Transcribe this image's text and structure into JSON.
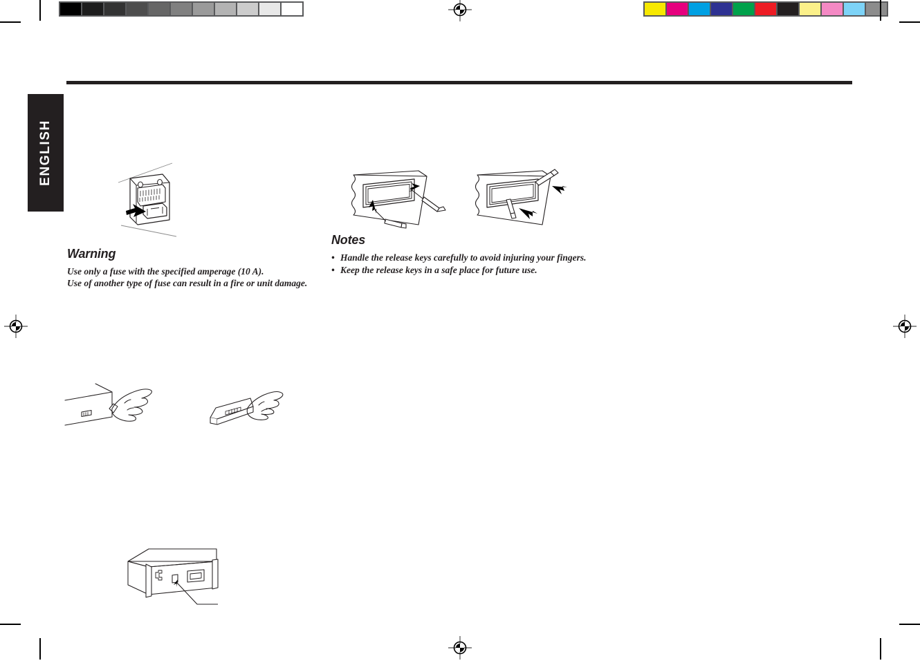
{
  "page": {
    "background_color": "#ffffff",
    "ink_color": "#231f20",
    "language_tab": {
      "label": "ENGLISH",
      "background_color": "#231f20",
      "text_color": "#ffffff"
    },
    "header_rule": {
      "color": "#231f20"
    }
  },
  "calibration": {
    "grayscale_strip": {
      "name": "grayscale-step-wedge",
      "frame_color": "#58595b",
      "patches": [
        {
          "label": "100%",
          "color": "#000000"
        },
        {
          "label": "90%",
          "color": "#1d1d1d"
        },
        {
          "label": "80%",
          "color": "#333333"
        },
        {
          "label": "70%",
          "color": "#4d4d4d"
        },
        {
          "label": "60%",
          "color": "#666666"
        },
        {
          "label": "50%",
          "color": "#808080"
        },
        {
          "label": "40%",
          "color": "#9a9a9a"
        },
        {
          "label": "30%",
          "color": "#b3b3b3"
        },
        {
          "label": "20%",
          "color": "#cccccc"
        },
        {
          "label": "10%",
          "color": "#e8e8e8"
        },
        {
          "label": "0%",
          "color": "#ffffff"
        }
      ]
    },
    "color_strip": {
      "name": "process-color-bar",
      "frame_color": "#58595b",
      "patches": [
        {
          "label": "Yellow",
          "color": "#f7e800"
        },
        {
          "label": "Magenta",
          "color": "#e6007e"
        },
        {
          "label": "Cyan",
          "color": "#00a0e3"
        },
        {
          "label": "Blue",
          "color": "#2e3192"
        },
        {
          "label": "Green",
          "color": "#00a14b"
        },
        {
          "label": "Red",
          "color": "#ed1c24"
        },
        {
          "label": "Black",
          "color": "#231f20"
        },
        {
          "label": "Light Yellow",
          "color": "#fbf08a"
        },
        {
          "label": "Pink",
          "color": "#f489c4"
        },
        {
          "label": "Light Blue",
          "color": "#7dd3f7"
        },
        {
          "label": "Gray",
          "color": "#8c8c8c"
        }
      ]
    },
    "registration_marks": [
      {
        "name": "registration-mark-top-center"
      },
      {
        "name": "registration-mark-left"
      },
      {
        "name": "registration-mark-right"
      },
      {
        "name": "registration-mark-bottom-center"
      }
    ]
  },
  "warning": {
    "heading": "Warning",
    "lines": [
      "Use only a fuse with the specified amperage (10 A).",
      "Use of another type of fuse can result in a fire or unit damage."
    ]
  },
  "notes": {
    "heading": "Notes",
    "items": [
      "Handle the release keys carefully to avoid injuring your fingers.",
      "Keep the release keys in a safe place for future use."
    ]
  },
  "figures": [
    {
      "name": "fuse-replacement-figure",
      "caption": "",
      "description": "Rear panel fuse holder with arrow showing the fuse being pulled out"
    },
    {
      "name": "release-key-insert-figure",
      "caption": "",
      "description": "Two release keys being inserted into the slots of the mounting sleeve"
    },
    {
      "name": "release-key-pull-figure",
      "caption": "",
      "description": "Release keys pulled outward to free the unit from the mounting sleeve"
    },
    {
      "name": "detach-faceplate-figure",
      "caption": "",
      "description": "Hand releasing the detachable control panel from the unit"
    },
    {
      "name": "hold-faceplate-figure",
      "caption": "",
      "description": "Hand holding the detached control panel"
    },
    {
      "name": "unit-rear-figure",
      "caption": "",
      "description": "Isometric view of the unit chassis with a leader line pointing at the fuse location"
    }
  ]
}
